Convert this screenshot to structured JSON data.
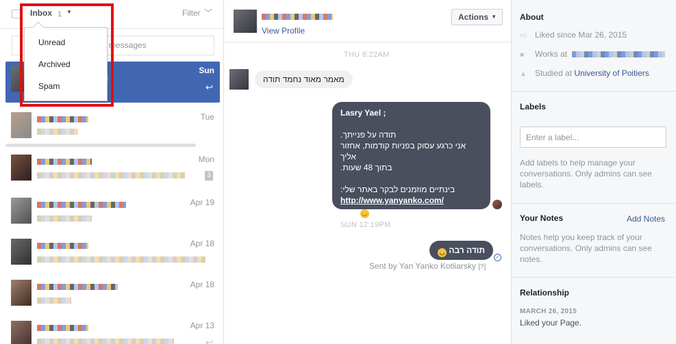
{
  "inbox": {
    "label": "Inbox",
    "count": "1",
    "filter_label": "Filter",
    "search_placeholder": "messages",
    "dropdown": [
      "Unread",
      "Archived",
      "Spam"
    ]
  },
  "threads": [
    {
      "date": "Sun",
      "active": true
    },
    {
      "date": "Tue"
    },
    {
      "date": "Mon",
      "badge": "3"
    },
    {
      "date": "Apr 19"
    },
    {
      "date": "Apr 18"
    },
    {
      "date": "Apr 18"
    },
    {
      "date": "Apr 13"
    }
  ],
  "conversation": {
    "view_profile": "View Profile",
    "actions_label": "Actions",
    "timestamp1": "THU 8:22AM",
    "incoming_message": "מאמר מאוד נחמד תודה",
    "outgoing": {
      "title": "Lasry Yael ;",
      "line1": "תודה על פנייתך.",
      "line2": "אני כרגע עסוק בפניות קודמות, אחזור אליך",
      "line3": "בתוך 48 שעות.",
      "line4": "בינתיים מוזמנים לבקר באתר שלי:",
      "link": "http://www.yanyanko.com/",
      "line5": "תודה"
    },
    "timestamp2": "SUN 12:19PM",
    "reply_message": "תודה רבה",
    "sent_by": "Sent by Yan Yanko Kotliarsky",
    "sent_by_help": "[?]"
  },
  "about": {
    "title": "About",
    "liked_since": "Liked since Mar 26, 2015",
    "works_at_prefix": "Works at",
    "studied_at_prefix": "Studied at",
    "studied_at_school": "University of Poitiers"
  },
  "labels": {
    "title": "Labels",
    "input_placeholder": "Enter a label...",
    "help": "Add labels to help manage your conversations. Only admins can see labels."
  },
  "notes": {
    "title": "Your Notes",
    "add_label": "Add Notes",
    "help": "Notes help you keep track of your conversations. Only admins can see notes."
  },
  "relationship": {
    "title": "Relationship",
    "date": "MARCH 26, 2015",
    "text": "Liked your Page."
  }
}
